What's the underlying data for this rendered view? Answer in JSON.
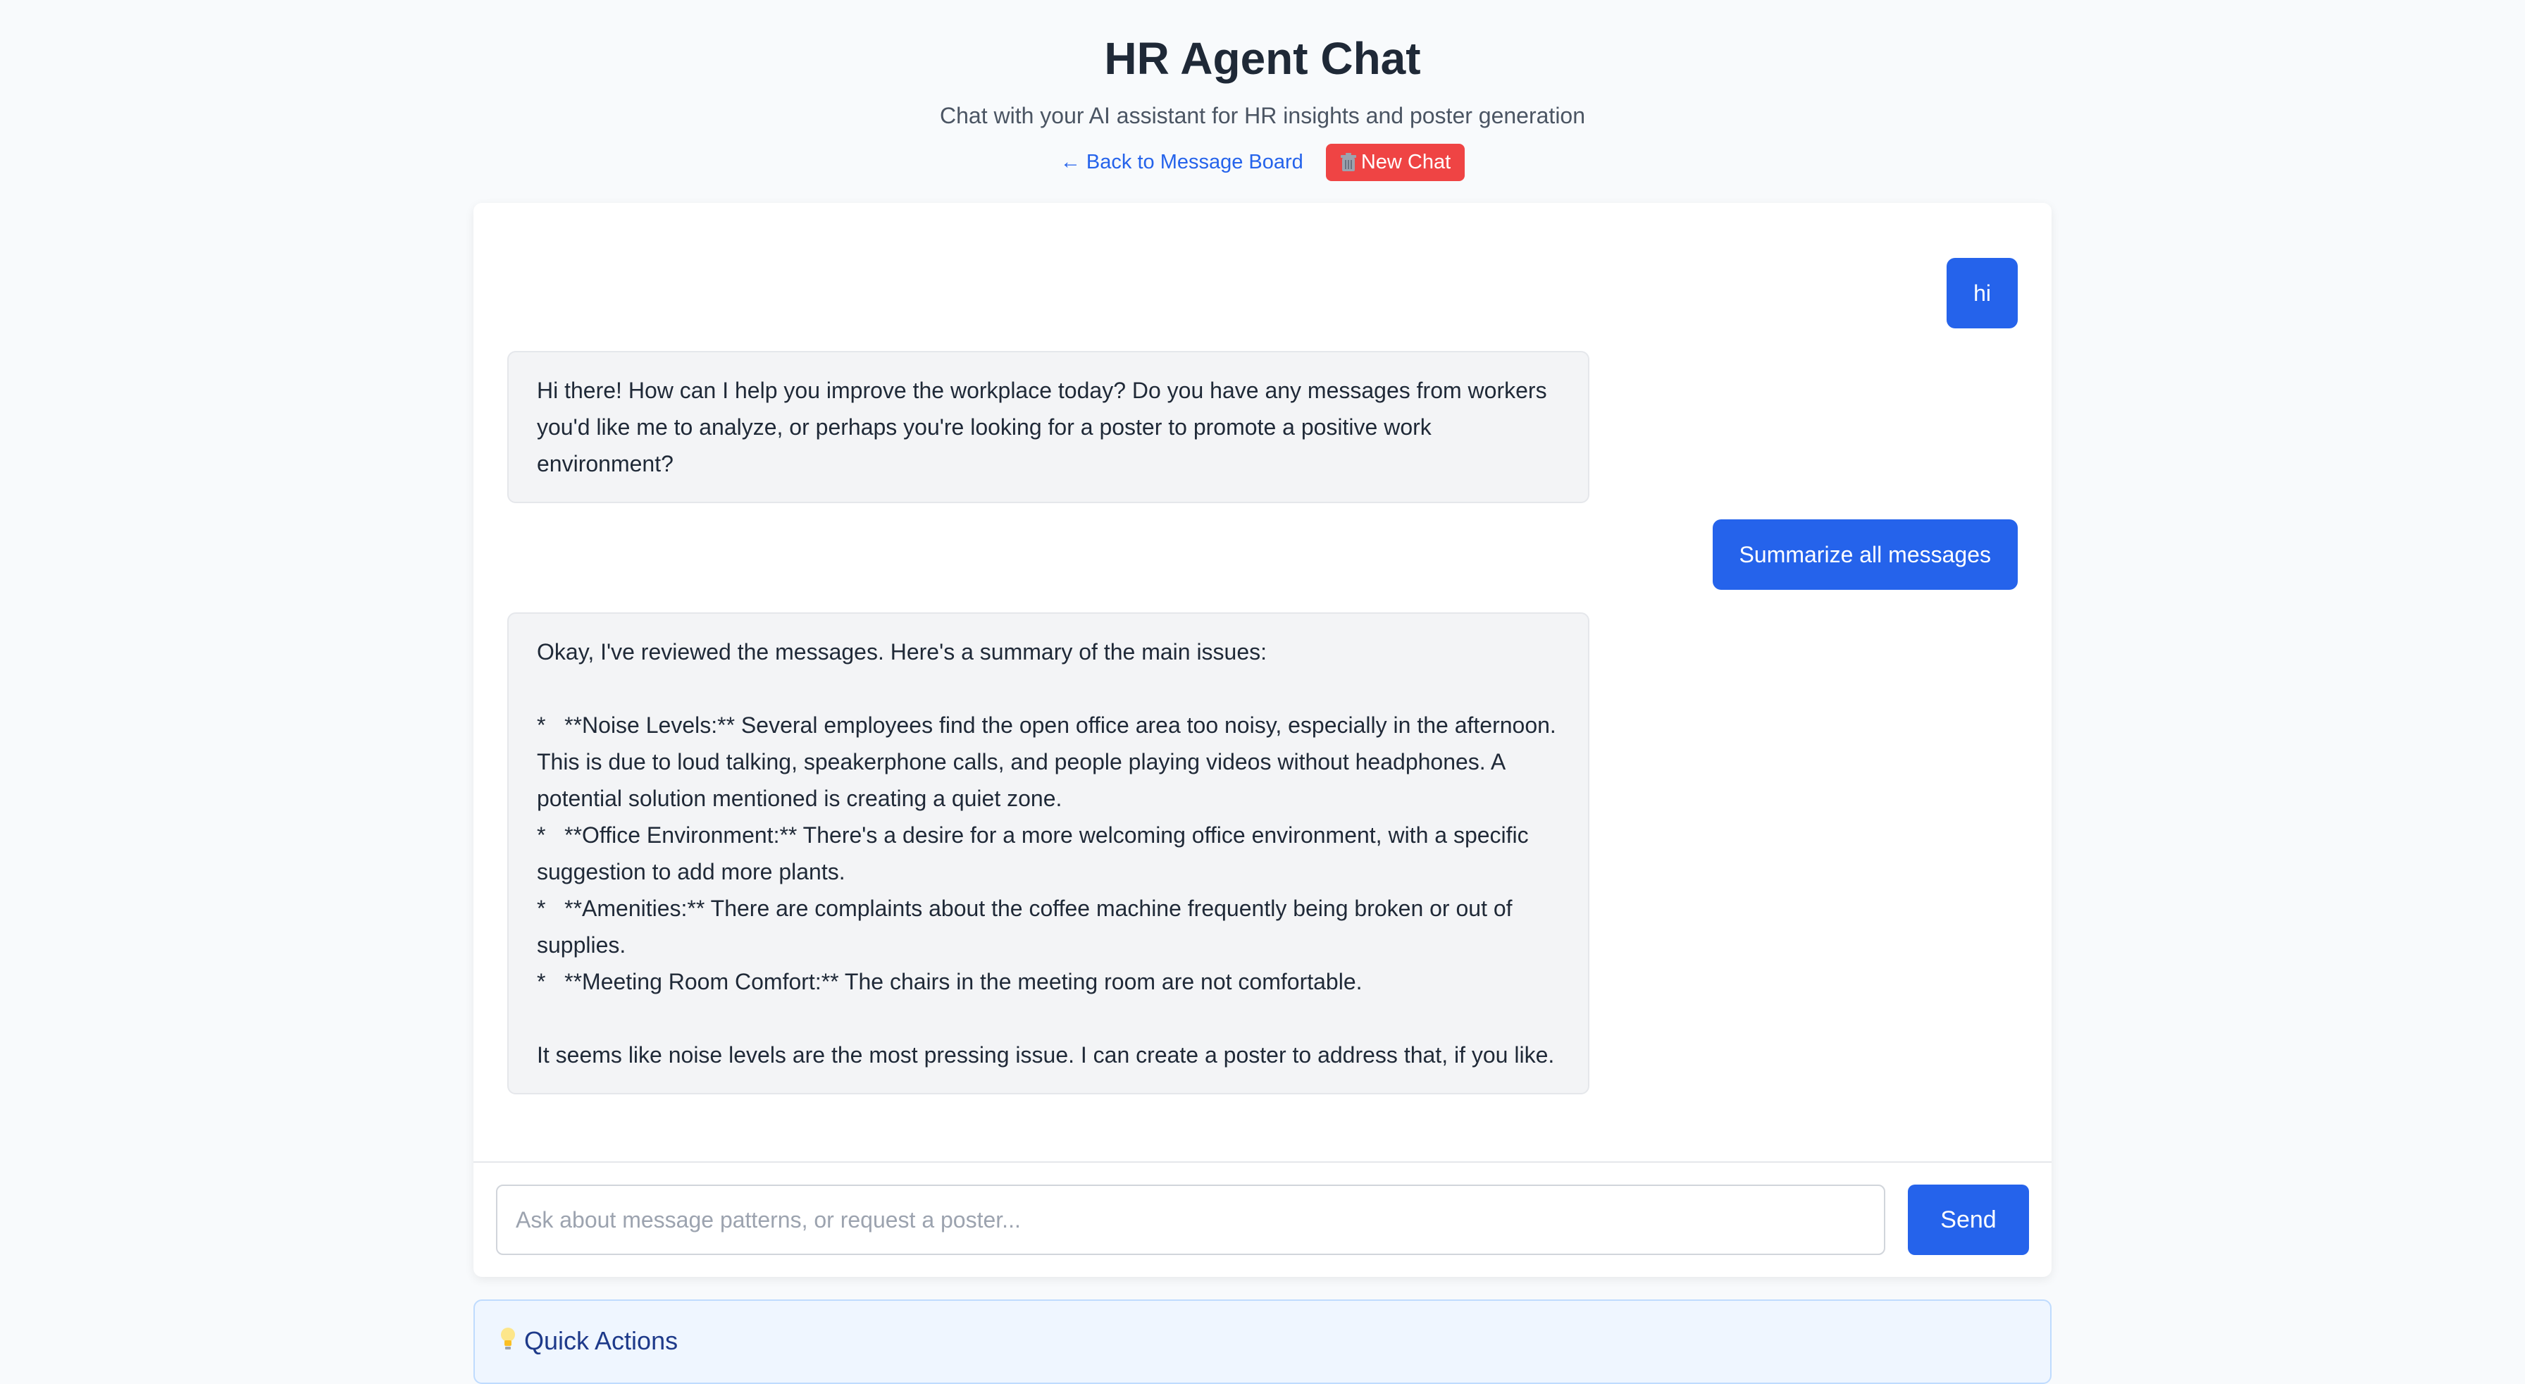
{
  "header": {
    "title": "HR Agent Chat",
    "subtitle": "Chat with your AI assistant for HR insights and poster generation",
    "back_link": "← Back to Message Board",
    "new_chat_label": "New Chat",
    "new_chat_icon": "trash-icon"
  },
  "colors": {
    "primary": "#2563eb",
    "danger": "#ef4444",
    "ai_bubble": "#f3f4f6",
    "background": "#f8fafc"
  },
  "messages": [
    {
      "role": "user",
      "text": "hi"
    },
    {
      "role": "assistant",
      "text": "Hi there! How can I help you improve the workplace today? Do you have any messages from workers you'd like me to analyze, or perhaps you're looking for a poster to promote a positive work environment?"
    },
    {
      "role": "user",
      "text": "Summarize all messages"
    },
    {
      "role": "assistant",
      "text": "Okay, I've reviewed the messages. Here's a summary of the main issues:\n\n*   **Noise Levels:** Several employees find the open office area too noisy, especially in the afternoon. This is due to loud talking, speakerphone calls, and people playing videos without headphones. A potential solution mentioned is creating a quiet zone.\n*   **Office Environment:** There's a desire for a more welcoming office environment, with a specific suggestion to add more plants.\n*   **Amenities:** There are complaints about the coffee machine frequently being broken or out of supplies.\n*   **Meeting Room Comfort:** The chairs in the meeting room are not comfortable.\n\nIt seems like noise levels are the most pressing issue. I can create a poster to address that, if you like."
    }
  ],
  "input": {
    "placeholder": "Ask about message patterns, or request a poster...",
    "value": "",
    "send_label": "Send"
  },
  "quick_actions": {
    "title": "Quick Actions",
    "icon": "lightbulb-icon"
  }
}
